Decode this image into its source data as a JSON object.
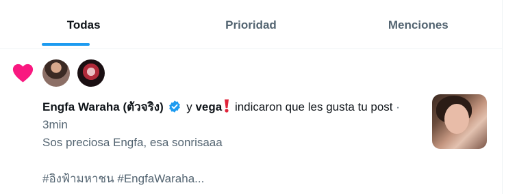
{
  "tabs": [
    {
      "label": "Todas",
      "active": true
    },
    {
      "label": "Prioridad",
      "active": false
    },
    {
      "label": "Menciones",
      "active": false
    }
  ],
  "notification": {
    "icon": "heart-icon",
    "icon_color": "#f91880",
    "user1_name": "Engfa Waraha (ตัวจริง)",
    "user1_verified": true,
    "conjunction": "y",
    "user2_name": "vega",
    "action_text": "indicaron que les gusta tu post",
    "separator": "·",
    "time": "3min",
    "post_text": "Sos preciosa Engfa, esa sonrisaaa",
    "hashtags": "#อิงฟ้ามหาชน #EngfaWaraha..."
  },
  "colors": {
    "accent": "#1d9bf0",
    "like": "#f91880",
    "secondary_text": "#536471",
    "primary_text": "#0f1419"
  }
}
